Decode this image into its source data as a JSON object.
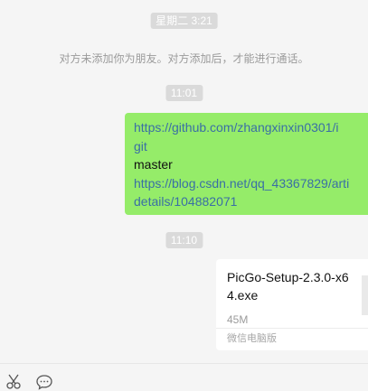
{
  "chat": {
    "timestamps": [
      "星期二 3:21",
      "11:01",
      "11:10"
    ],
    "system_notice": "对方未添加你为朋友。对方添加后，才能进行通话。",
    "message": {
      "lines": [
        "https://github.com/zhangxinxin0301/i",
        "git",
        "master",
        "https://blog.csdn.net/qq_43367829/arti",
        "details/104882071"
      ]
    },
    "file": {
      "name": "PicGo-Setup-2.3.0-x64.exe",
      "size": "45M",
      "source": "微信电脑版",
      "icon": "file-icon"
    }
  },
  "toolbar": {
    "icons": [
      "scissors-icon",
      "chat-bubble-icon"
    ]
  },
  "colors": {
    "background": "#f5f5f5",
    "bubble": "#95ec69",
    "link": "#3a6fa5",
    "timestamp_bg": "#dadada"
  }
}
